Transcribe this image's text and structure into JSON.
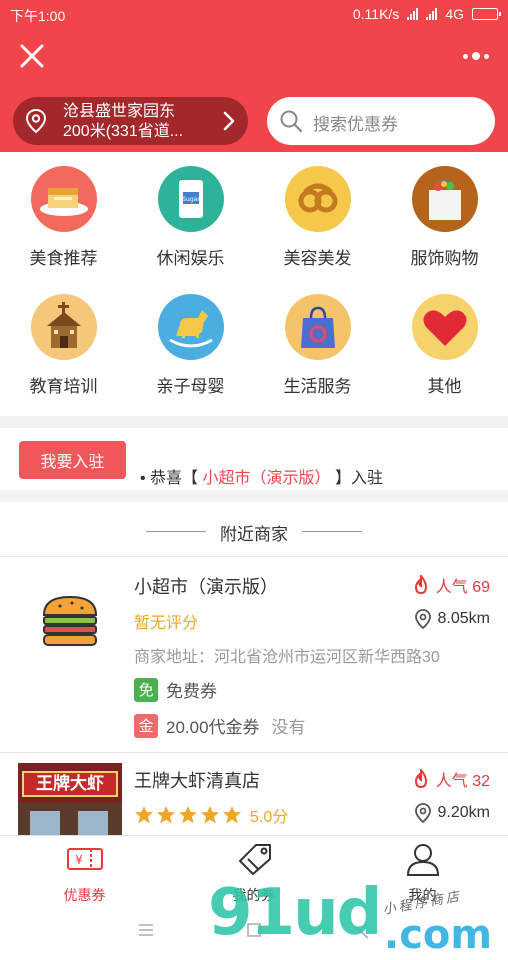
{
  "status_bar": {
    "time": "下午1:00",
    "net_speed": "0.11K/s",
    "network": "4G"
  },
  "header": {
    "location_line1": "沧县盛世家园东",
    "location_line2": "200米(331省道...",
    "search_placeholder": "搜索优惠券"
  },
  "categories": [
    {
      "label": "美食推荐",
      "icon": "cake-icon",
      "color": "#f26a5e"
    },
    {
      "label": "休闲娱乐",
      "icon": "sugar-bag-icon",
      "color": "#2db39a"
    },
    {
      "label": "美容美发",
      "icon": "pretzel-icon",
      "color": "#f5c74a"
    },
    {
      "label": "服饰购物",
      "icon": "shopping-bag-icon",
      "color": "#b5641c"
    },
    {
      "label": "教育培训",
      "icon": "school-house-icon",
      "color": "#f5c77a"
    },
    {
      "label": "亲子母婴",
      "icon": "rocking-horse-icon",
      "color": "#4aaee0"
    },
    {
      "label": "生活服务",
      "icon": "tote-bag-icon",
      "color": "#f5c46a"
    },
    {
      "label": "其他",
      "icon": "heart-icon",
      "color": "#f5d36a"
    }
  ],
  "join": {
    "button_label": "我要入驻",
    "ticker_prefix": "• 恭喜【",
    "ticker_shop": "小超市（演示版）",
    "ticker_suffix": "】入驻"
  },
  "nearby": {
    "title": "附近商家",
    "shops": [
      {
        "name": "小超市（演示版）",
        "popularity": "人气 69",
        "rating_text": "暂无评分",
        "distance": "8.05km",
        "address": "商家地址：河北省沧州市运河区新华西路30",
        "free_tag": "免",
        "free_label": "免费券",
        "cash_tag": "金",
        "cash_label": "20.00代金券",
        "cash_status": "没有"
      },
      {
        "name": "王牌大虾清真店",
        "popularity": "人气 32",
        "stars": 5,
        "score": "5.0分",
        "distance": "9.20km",
        "photo_sign": "王牌大虾"
      }
    ]
  },
  "tabbar": {
    "tabs": [
      {
        "label": "优惠券",
        "active": true
      },
      {
        "label": "我的券",
        "active": false
      },
      {
        "label": "我的",
        "active": false
      }
    ]
  },
  "watermark": {
    "main": "91ud",
    "domain": ".com",
    "tagline": "小程序商店"
  },
  "colors": {
    "brand_red": "#f0454a",
    "dark_red": "#a3282c",
    "popular": "#e8393c",
    "star": "#f0a629"
  }
}
